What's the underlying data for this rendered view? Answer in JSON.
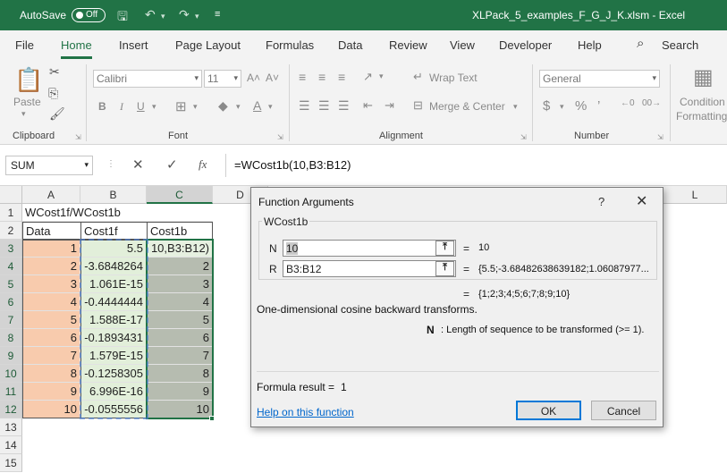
{
  "window": {
    "autosave_label": "AutoSave",
    "autosave_state": "Off",
    "document_title": "XLPack_5_examples_F_G_J_K.xlsm  -  Excel"
  },
  "ribbon": {
    "tabs": [
      "File",
      "Home",
      "Insert",
      "Page Layout",
      "Formulas",
      "Data",
      "Review",
      "View",
      "Developer",
      "Help"
    ],
    "active_tab": "Home",
    "search_label": "Search",
    "clipboard": {
      "paste_label": "Paste",
      "group_label": "Clipboard"
    },
    "font": {
      "name": "Calibri",
      "size": "11",
      "bold": "B",
      "italic": "I",
      "underline": "U",
      "group_label": "Font"
    },
    "alignment": {
      "wrap_text": "Wrap Text",
      "merge_center": "Merge & Center",
      "group_label": "Alignment"
    },
    "number": {
      "format": "General",
      "group_label": "Number"
    },
    "styles": {
      "conditional_line1": "Condition",
      "conditional_line2": "Formatting"
    }
  },
  "formula_bar": {
    "name_box": "SUM",
    "formula": "=WCost1b(10,B3:B12)",
    "fx_label": "fx"
  },
  "sheet": {
    "columns": [
      "A",
      "B",
      "C",
      "D",
      "L"
    ],
    "selected_column": "C",
    "row_numbers": [
      "1",
      "2",
      "3",
      "4",
      "5",
      "6",
      "7",
      "8",
      "9",
      "10",
      "11",
      "12",
      "13",
      "14",
      "15"
    ],
    "a1": "WCost1f/WCost1b",
    "headers": [
      "Data",
      "Cost1f",
      "Cost1b"
    ],
    "rows": [
      {
        "data": "1",
        "cost1f": "5.5",
        "cost1b": "10,B3:B12)"
      },
      {
        "data": "2",
        "cost1f": "-3.6848264",
        "cost1b": "2"
      },
      {
        "data": "3",
        "cost1f": "1.061E-15",
        "cost1b": "3"
      },
      {
        "data": "4",
        "cost1f": "-0.4444444",
        "cost1b": "4"
      },
      {
        "data": "5",
        "cost1f": "1.588E-17",
        "cost1b": "5"
      },
      {
        "data": "6",
        "cost1f": "-0.1893431",
        "cost1b": "6"
      },
      {
        "data": "7",
        "cost1f": "1.579E-15",
        "cost1b": "7"
      },
      {
        "data": "8",
        "cost1f": "-0.1258305",
        "cost1b": "8"
      },
      {
        "data": "9",
        "cost1f": "6.996E-16",
        "cost1b": "9"
      },
      {
        "data": "10",
        "cost1f": "-0.0555556",
        "cost1b": "10"
      }
    ]
  },
  "dialog": {
    "title": "Function Arguments",
    "help_glyph": "?",
    "function_name": "WCost1b",
    "arg_n_label": "N",
    "arg_n_value": "10",
    "arg_n_result": "10",
    "arg_r_label": "R",
    "arg_r_value": "B3:B12",
    "arg_r_result": "{5.5;-3.68482638639182;1.06087977...",
    "equals": "=",
    "function_result": "{1;2;3;4;5;6;7;8;9;10}",
    "description": "One-dimensional cosine backward transforms.",
    "arg_help_name": "N",
    "arg_help_text": ": Length of sequence to be transformed (>= 1).",
    "formula_result_label": "Formula result =",
    "formula_result_value": "1",
    "help_link": "Help on this function",
    "ok_label": "OK",
    "cancel_label": "Cancel"
  }
}
